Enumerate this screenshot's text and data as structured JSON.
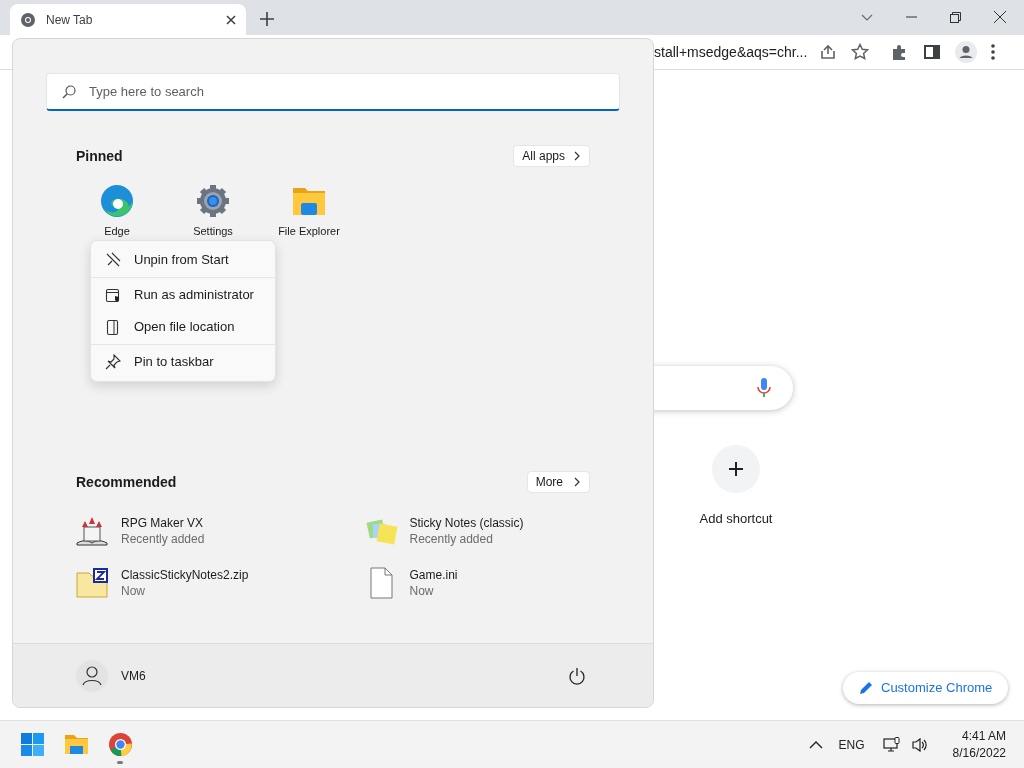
{
  "browser": {
    "tabs": [
      {
        "title": "New Tab",
        "selected": true
      }
    ],
    "address_text": "stall+msedge&aqs=chr...",
    "new_tab_page": {
      "add_shortcut": "Add shortcut",
      "customize_button": "Customize Chrome"
    }
  },
  "start_menu": {
    "search": {
      "placeholder": "Type here to search"
    },
    "pinned": {
      "heading": "Pinned",
      "all_apps_button": "All apps",
      "apps": [
        {
          "label": "Edge"
        },
        {
          "label": "Settings"
        },
        {
          "label": "File Explorer"
        }
      ]
    },
    "context_menu": [
      {
        "label": "Unpin from Start",
        "divider_below": true
      },
      {
        "label": "Run as administrator",
        "divider_below": false
      },
      {
        "label": "Open file location",
        "divider_below": true
      },
      {
        "label": "Pin to taskbar",
        "divider_below": false
      }
    ],
    "recommended": {
      "heading": "Recommended",
      "more_button": "More",
      "items": [
        {
          "name": "RPG Maker VX",
          "detail": "Recently added"
        },
        {
          "name": "Sticky Notes (classic)",
          "detail": "Recently added"
        },
        {
          "name": "ClassicStickyNotes2.zip",
          "detail": "Now"
        },
        {
          "name": "Game.ini",
          "detail": "Now"
        }
      ]
    },
    "user": {
      "name": "VM6"
    }
  },
  "taskbar": {
    "apps": [
      {
        "running": false
      },
      {
        "running": false
      },
      {
        "running": true
      }
    ],
    "tray": {
      "language": "ENG",
      "time": "4:41 AM",
      "date": "8/16/2022"
    }
  }
}
